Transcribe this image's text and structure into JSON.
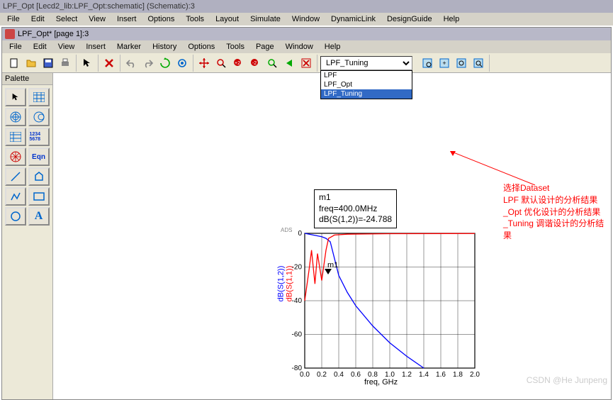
{
  "title": "LPF_Opt [Lecd2_lib:LPF_Opt:schematic] (Schematic):3",
  "main_menu": [
    "File",
    "Edit",
    "Select",
    "View",
    "Insert",
    "Options",
    "Tools",
    "Layout",
    "Simulate",
    "Window",
    "DynamicLink",
    "DesignGuide",
    "Help"
  ],
  "sub_title": "LPF_Opt* [page 1]:3",
  "sub_menu": [
    "File",
    "Edit",
    "View",
    "Insert",
    "Marker",
    "History",
    "Options",
    "Tools",
    "Page",
    "Window",
    "Help"
  ],
  "palette": {
    "title": "Palette"
  },
  "dropdown": {
    "selected": "LPF_Tuning",
    "items": [
      "LPF",
      "LPF_Opt",
      "LPF_Tuning"
    ],
    "highlighted": "LPF_Tuning"
  },
  "marker": {
    "name": "m1",
    "line2": "freq=400.0MHz",
    "line3": "dB(S(1,2))=-24.788"
  },
  "annotation": {
    "line1": "选择Dataset",
    "line2": "LPF 默认设计的分析结果",
    "line3": "_Opt 优化设计的分析结果",
    "line4": "_Tuning 调谐设计的分析结果"
  },
  "chart_data": {
    "type": "line",
    "xlabel": "freq, GHz",
    "ylabel_blue": "dB(S(1,2))",
    "ylabel_red": "dB(S(1,1))",
    "xlim": [
      0.0,
      2.0
    ],
    "ylim": [
      -80,
      0
    ],
    "xticks": [
      0.0,
      0.2,
      0.4,
      0.6,
      0.8,
      1.0,
      1.2,
      1.4,
      1.6,
      1.8,
      2.0
    ],
    "yticks": [
      -80,
      -60,
      -40,
      -20,
      0
    ],
    "series": [
      {
        "name": "dB(S(1,2))",
        "color": "#0000ff",
        "x": [
          0.0,
          0.1,
          0.2,
          0.25,
          0.3,
          0.4,
          0.5,
          0.6,
          0.8,
          1.0,
          1.2,
          1.4
        ],
        "y": [
          0,
          -1,
          -2,
          -3,
          -5,
          -25,
          -35,
          -43,
          -55,
          -65,
          -73,
          -80
        ]
      },
      {
        "name": "dB(S(1,1))",
        "color": "#ff0000",
        "x": [
          0.0,
          0.05,
          0.08,
          0.12,
          0.15,
          0.2,
          0.25,
          0.28,
          0.35,
          0.5,
          1.0,
          2.0
        ],
        "y": [
          -40,
          -22,
          -10,
          -30,
          -12,
          -28,
          -10,
          -3,
          -1,
          -0.5,
          -0.2,
          -0.1
        ]
      }
    ],
    "marker": {
      "name": "m1",
      "x": 0.4,
      "y": -24.788
    }
  },
  "watermark": "CSDN @He Junpeng",
  "pal_eqn": "Eqn",
  "pal_nums": "1234\n5678"
}
